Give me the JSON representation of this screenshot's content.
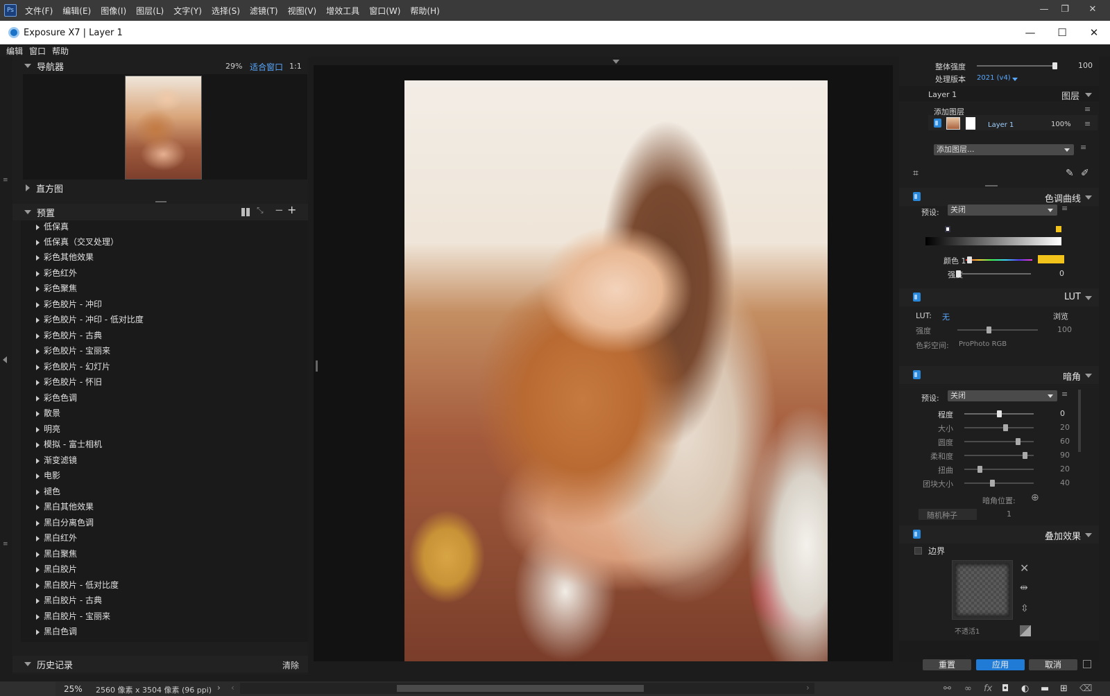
{
  "ps": {
    "logo": "Ps",
    "menus": [
      "文件(F)",
      "编辑(E)",
      "图像(I)",
      "图层(L)",
      "文字(Y)",
      "选择(S)",
      "滤镜(T)",
      "视图(V)",
      "增效工具",
      "窗口(W)",
      "帮助(H)"
    ]
  },
  "titlebar": {
    "title": "Exposure X7 | Layer 1"
  },
  "appmenu": [
    "编辑",
    "窗口",
    "帮助"
  ],
  "navigator": {
    "title": "导航器",
    "zoom": "29%",
    "fit": "适合窗口",
    "one": "1:1"
  },
  "histogram": {
    "title": "直方图"
  },
  "presets": {
    "title": "预置",
    "items": [
      "低保真",
      "低保真（交叉处理）",
      "彩色其他效果",
      "彩色红外",
      "彩色聚焦",
      "彩色胶片 - 冲印",
      "彩色胶片 - 冲印 - 低对比度",
      "彩色胶片 - 古典",
      "彩色胶片 - 宝丽来",
      "彩色胶片 - 幻灯片",
      "彩色胶片 - 怀旧",
      "彩色色调",
      "散景",
      "明亮",
      "模拟 - 富士相机",
      "渐变滤镜",
      "电影",
      "褪色",
      "黑白其他效果",
      "黑白分离色调",
      "黑白红外",
      "黑白聚焦",
      "黑白胶片",
      "黑白胶片 - 低对比度",
      "黑白胶片 - 古典",
      "黑白胶片 - 宝丽来",
      "黑白色调"
    ]
  },
  "history": {
    "title": "历史记录",
    "clear": "清除"
  },
  "right": {
    "overall_label": "整体强度",
    "overall_value": "100",
    "overall_level": 1.0,
    "version_label": "处理版本",
    "version_value": "2021 (v4)",
    "layer_name": "Layer 1",
    "layers_title": "图层",
    "add_layer": "添加图层",
    "layer_item": "Layer 1",
    "layer_opacity": "100%",
    "add_layer_select": "添加图层...",
    "curve_title": "色调曲线",
    "preset_label": "预设:",
    "preset_value": "关闭",
    "color1_label": "颜色 1",
    "strength_label": "强度",
    "strength_value": "0",
    "lut_title": "LUT",
    "lut_label": "LUT:",
    "lut_value": "无",
    "browse": "浏览",
    "lut_strength_label": "强度",
    "lut_strength_value": "100",
    "colorspace_label": "色彩空间:",
    "colorspace_value": "ProPhoto RGB",
    "vignette_title": "暗角",
    "vpreset_label": "预设:",
    "vpreset_value": "关闭",
    "vrows": [
      {
        "label": "程度",
        "value": "0",
        "level": 0.5
      },
      {
        "label": "大小",
        "value": "20",
        "level": 0.6
      },
      {
        "label": "圆度",
        "value": "60",
        "level": 0.8
      },
      {
        "label": "柔和度",
        "value": "90",
        "level": 0.9
      },
      {
        "label": "扭曲",
        "value": "20",
        "level": 0.2
      },
      {
        "label": "团块大小",
        "value": "40",
        "level": 0.4
      }
    ],
    "vpos_label": "暗角位置:",
    "seed_label": "随机种子",
    "seed_value": "1",
    "overlay_title": "叠加效果",
    "border_label": "边界",
    "opacity_label": "不透活1",
    "reset": "重置",
    "apply": "应用",
    "cancel": "取消"
  },
  "status": {
    "zoom": "25%",
    "info": "2560 像素 x 3504 像素 (96 ppi)"
  },
  "colors": {
    "accent": "#2a86d6",
    "color1_swatch": "#f2c31b"
  }
}
